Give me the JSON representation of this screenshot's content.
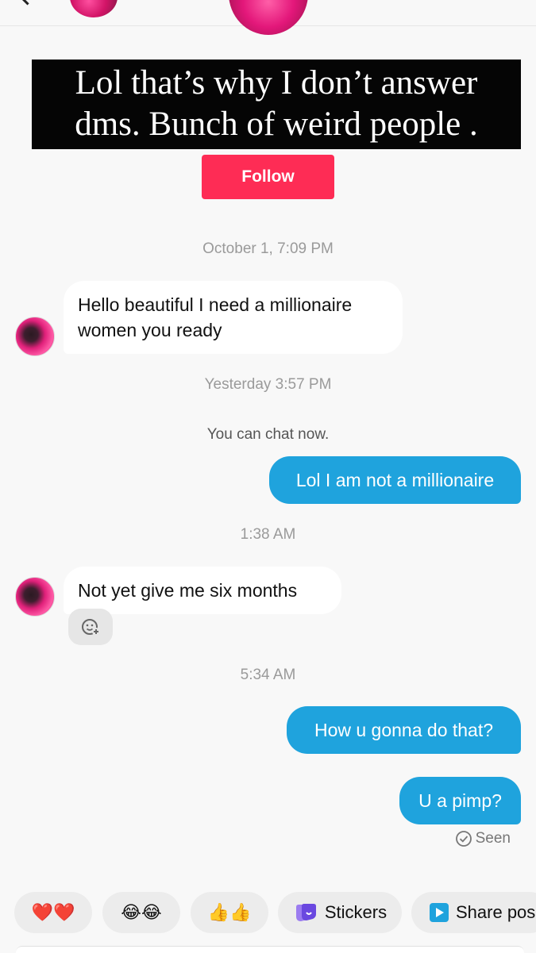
{
  "overlay": {
    "line1": "Lol that’s why I don’t answer",
    "line2": "dms. Bunch of weird people ."
  },
  "profile": {
    "follow_label": "Follow"
  },
  "messages": [
    {
      "type": "timestamp",
      "text": "October 1, 7:09 PM"
    },
    {
      "type": "incoming",
      "text": "Hello beautiful I need a millionaire women you ready"
    },
    {
      "type": "timestamp",
      "text": "Yesterday 3:57 PM"
    },
    {
      "type": "system",
      "text": "You can chat now."
    },
    {
      "type": "outgoing",
      "text": "Lol I am not a millionaire"
    },
    {
      "type": "timestamp",
      "text": "1:38 AM"
    },
    {
      "type": "incoming",
      "text": "Not yet give me six months"
    },
    {
      "type": "timestamp",
      "text": "5:34 AM"
    },
    {
      "type": "outgoing",
      "text": "How u gonna do that?"
    },
    {
      "type": "outgoing",
      "text": "U a pimp?"
    }
  ],
  "status": {
    "seen_label": "Seen"
  },
  "quick_replies": [
    {
      "label": "❤️❤️",
      "icon": "hearts"
    },
    {
      "label": "😂😂",
      "icon": "laughing"
    },
    {
      "label": "👍👍",
      "icon": "thumbs-up"
    },
    {
      "label": "Stickers",
      "icon": "stickers-icon"
    },
    {
      "label": "Share pos",
      "icon": "share-post-icon"
    }
  ],
  "colors": {
    "follow": "#fe2c55",
    "outgoing_bubble": "#1fa3dd",
    "background": "#f8f8f8"
  }
}
